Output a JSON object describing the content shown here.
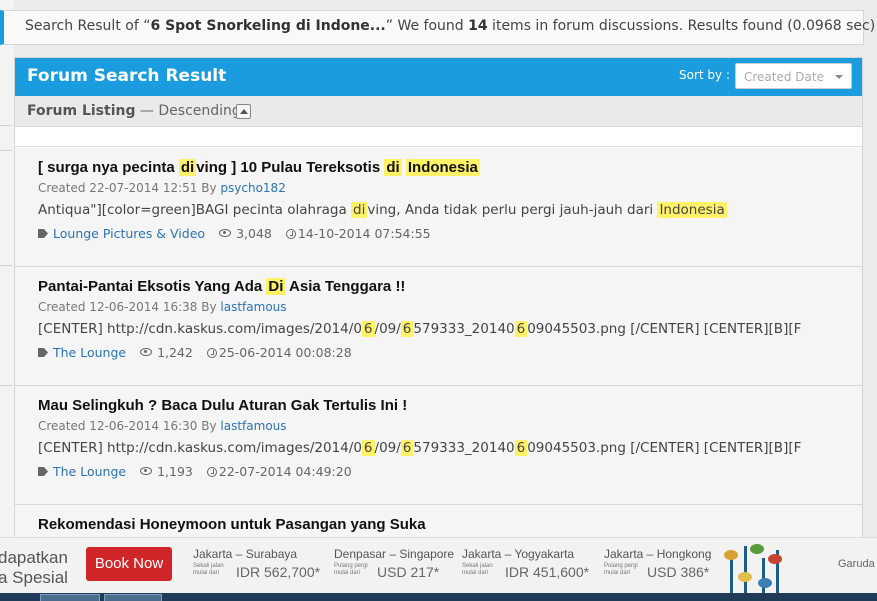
{
  "search_summary": {
    "prefix": "Search Result of “",
    "query": "6 Spot Snorkeling di Indone...",
    "mid": "” We found ",
    "count": "14",
    "suffix": " items in forum discussions. Results found (0.0968 sec)"
  },
  "panel": {
    "title": "Forum Search Result",
    "sort_label": "Sort by :",
    "sort_placeholder": "Created Date"
  },
  "listing": {
    "label": "Forum Listing",
    "separator": " — ",
    "order": "Descending"
  },
  "results": [
    {
      "title": [
        "[ surga nya pecinta ",
        "di",
        "ving ] 10 Pulau Tereksotis ",
        "di",
        " ",
        "Indonesia",
        ""
      ],
      "created_prefix": "Created 22-07-2014 12:51 By ",
      "author": "psycho182",
      "snippet": [
        "Antiqua\"][color=green]BAGI pecinta olahraga ",
        "di",
        "ving, Anda tidak perlu pergi jauh-jauh dari ",
        "Indonesia",
        ""
      ],
      "category": "Lounge Pictures & Video",
      "views": "3,048",
      "last_post": "14-10-2014 07:54:55"
    },
    {
      "title": [
        "Pantai-Pantai Eksotis Yang Ada ",
        "Di",
        " Asia Tenggara !!"
      ],
      "created_prefix": "Created 12-06-2014 16:38 By ",
      "author": "lastfamous",
      "snippet": [
        "[CENTER] http://cdn.kaskus.com/images/2014/0",
        "6",
        "/09/",
        "6",
        "579333_20140",
        "6",
        "09045503.png [/CENTER] [CENTER][B][F"
      ],
      "category": "The Lounge",
      "views": "1,242",
      "last_post": "25-06-2014 00:08:28"
    },
    {
      "title": [
        "Mau Selingkuh ? Baca Dulu Aturan Gak Tertulis Ini !"
      ],
      "created_prefix": "Created 12-06-2014 16:30 By ",
      "author": "lastfamous",
      "snippet": [
        "[CENTER] http://cdn.kaskus.com/images/2014/0",
        "6",
        "/09/",
        "6",
        "579333_20140",
        "6",
        "09045503.png [/CENTER] [CENTER][B][F"
      ],
      "category": "The Lounge",
      "views": "1,193",
      "last_post": "22-07-2014 04:49:20"
    },
    {
      "title": [
        "Rekomendasi Honeymoon untuk Pasangan yang Suka"
      ],
      "created_prefix": "",
      "author": "",
      "snippet": [
        ""
      ],
      "category": "",
      "views": "",
      "last_post": ""
    }
  ],
  "ad": {
    "promo_line1": "dapatkan",
    "promo_line2": "a Spesial",
    "book_button": "Book Now",
    "sub_label": "Sekali jalan mulai dari",
    "sub_label_b": "Pulang pergi mulai dari",
    "routes": [
      {
        "name": "Jakarta – Surabaya",
        "price": "IDR 562,700*",
        "sub": "Sekali jalan mulai dari"
      },
      {
        "name": "Denpasar – Singapore",
        "price": "USD 217*",
        "sub": "Pulang pergi mulai dari"
      },
      {
        "name": "Jakarta – Yogyakarta",
        "price": "IDR 451,600*",
        "sub": "Sekali jalan mulai dari"
      },
      {
        "name": "Jakarta – Hongkong",
        "price": "USD 386*",
        "sub": "Pulang pergi mulai dari"
      }
    ],
    "airline": "Garuda In",
    "colors": {
      "button": "#d0262a"
    }
  },
  "colors": {
    "accent": "#1a9cde",
    "highlight": "#fff266",
    "link": "#2a73b8"
  }
}
